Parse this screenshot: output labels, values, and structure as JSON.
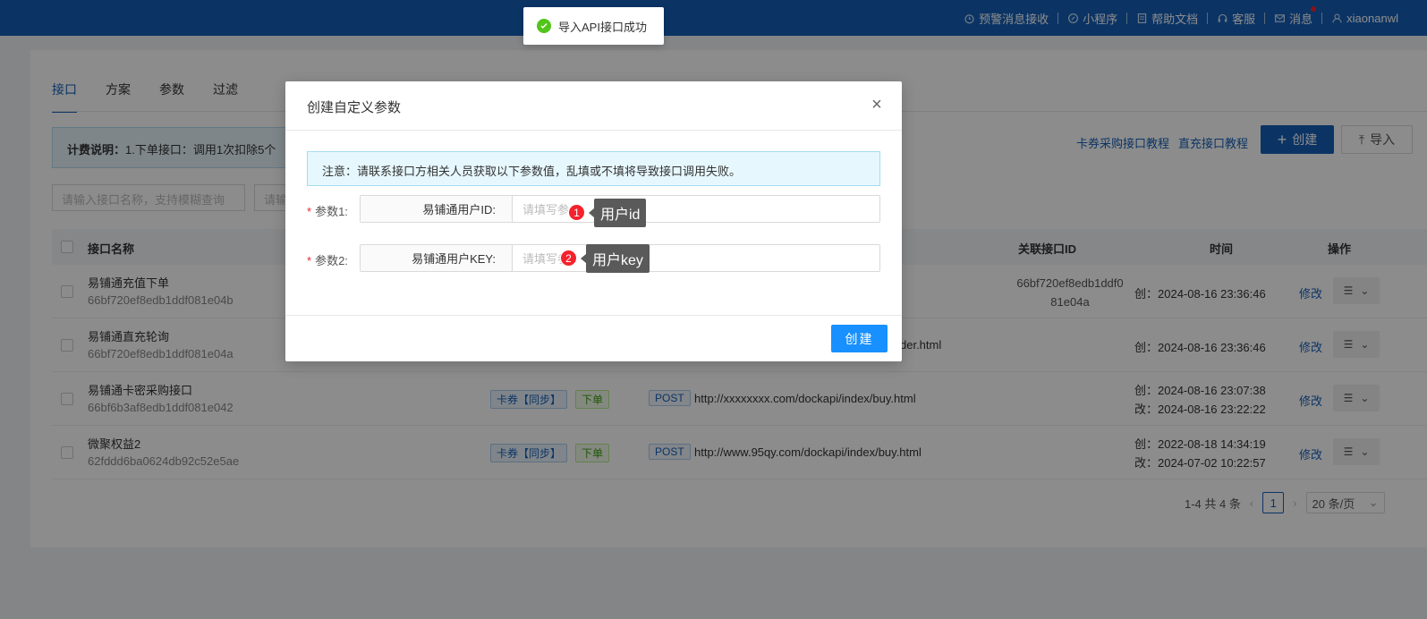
{
  "topnav": {
    "items": [
      {
        "label": "预警消息接收",
        "icon": "alarm-icon"
      },
      {
        "label": "小程序",
        "icon": "mini-program-icon"
      },
      {
        "label": "帮助文档",
        "icon": "document-icon"
      },
      {
        "label": "客服",
        "icon": "headset-icon"
      },
      {
        "label": "消息",
        "icon": "mail-icon"
      },
      {
        "label": "xiaonanwl",
        "icon": "user-icon"
      }
    ]
  },
  "tabs": [
    "接口",
    "方案",
    "参数",
    "过滤"
  ],
  "billing_notice": {
    "title": "计费说明：",
    "text": "1.下单接口：调用1次扣除5个"
  },
  "toolbar": {
    "links": [
      "卡券采购接口教程",
      "直充接口教程"
    ],
    "create_label": "创建",
    "import_label": "导入"
  },
  "search": {
    "placeholder1": "请输入接口名称，支持模糊查询",
    "placeholder2": "请输"
  },
  "table": {
    "headers": {
      "name": "接口名称",
      "rel": "关联接口ID",
      "time": "时间",
      "op": "操作"
    },
    "rows": [
      {
        "name": "易铺通充值下单",
        "id": "66bf720ef8edb1ddf081e04b",
        "tags": [],
        "method": "",
        "url": "l",
        "rel_id": "66bf720ef8edb1ddf081e04a",
        "time1": "创：2024-08-16 23:36:46",
        "time2": "",
        "edit": "修改"
      },
      {
        "name": "易铺通直充轮询",
        "id": "66bf720ef8edb1ddf081e04a",
        "tags": [],
        "method": "",
        "url": "der.html",
        "rel_id": "",
        "time1": "创：2024-08-16 23:36:46",
        "time2": "",
        "edit": "修改"
      },
      {
        "name": "易铺通卡密采购接口",
        "id": "66bf6b3af8edb1ddf081e042",
        "tags": [
          "卡券【同步】",
          "下单"
        ],
        "method": "POST",
        "url": "http://xxxxxxxx.com/dockapi/index/buy.html",
        "rel_id": "",
        "time1": "创：2024-08-16 23:07:38",
        "time2": "改：2024-08-16 23:22:22",
        "edit": "修改"
      },
      {
        "name": "微聚权益2",
        "id": "62fddd6ba0624db92c52e5ae",
        "tags": [
          "卡券【同步】",
          "下单"
        ],
        "method": "POST",
        "url": "http://www.95qy.com/dockapi/index/buy.html",
        "rel_id": "",
        "time1": "创：2022-08-18 14:34:19",
        "time2": "改：2024-07-02 10:22:57",
        "edit": "修改"
      }
    ]
  },
  "pagination": {
    "summary": "1-4 共 4 条",
    "current": "1",
    "page_size": "20 条/页"
  },
  "toast": {
    "text": "导入API接口成功"
  },
  "modal": {
    "title": "创建自定义参数",
    "alert": "注意：请联系接口方相关人员获取以下参数值，乱填或不填将导致接口调用失败。",
    "fields": [
      {
        "label": "参数1:",
        "addon": "易铺通用户ID:",
        "placeholder": "请填写参"
      },
      {
        "label": "参数2:",
        "addon": "易铺通用户KEY:",
        "placeholder": "请填写参"
      }
    ],
    "submit_label": "创建"
  },
  "annotations": [
    {
      "number": "1",
      "text": "用户id"
    },
    {
      "number": "2",
      "text": "用户key"
    }
  ]
}
